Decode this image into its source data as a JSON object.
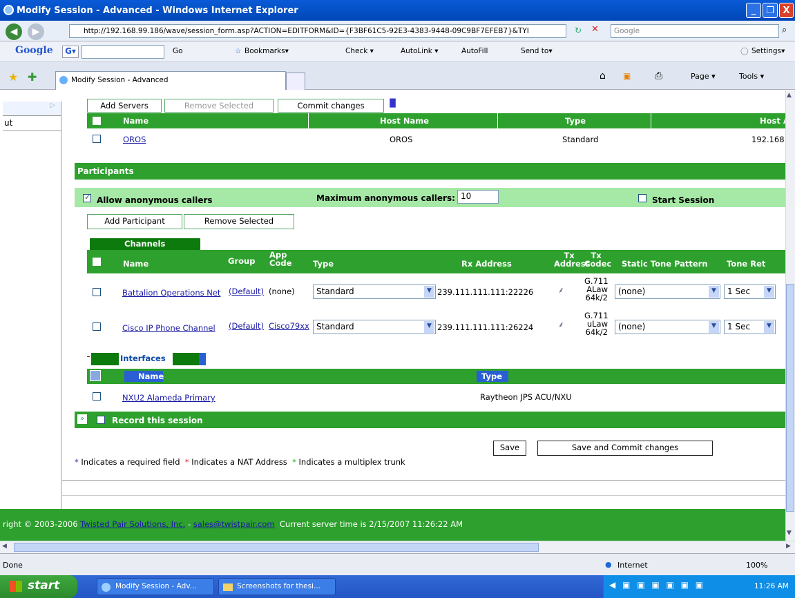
{
  "window": {
    "title": "Modify Session - Advanced - Windows Internet Explorer",
    "minimize": "_",
    "maximize": "❐",
    "close": "X"
  },
  "address": {
    "url": "http://192.168.99.186/wave/session_form.asp?ACTION=EDITFORM&ID={F3BF61C5-92E3-4383-9448-09C9BF7EFEB7}&TYI",
    "search_placeholder": "Google"
  },
  "google_bar": {
    "brand": "Google",
    "go": "Go",
    "bookmarks": "Bookmarks▾",
    "check": "Check ▾",
    "autolink": "AutoLink ▾",
    "autofill": "AutoFill",
    "send_to": "Send to▾",
    "settings": "Settings▾"
  },
  "tabs": {
    "active": "Modify Session - Advanced",
    "page": "Page ▾",
    "tools": "Tools ▾"
  },
  "left_nav": {
    "item": "ut"
  },
  "servers": {
    "buttons": {
      "add": "Add Servers",
      "remove": "Remove Selected",
      "commit": "Commit changes"
    },
    "headers": {
      "name": "Name",
      "host_name": "Host Name",
      "type": "Type",
      "host_address": "Host A"
    },
    "rows": [
      {
        "name": "OROS",
        "host_name": "OROS",
        "type": "Standard",
        "host_address": "192.168"
      }
    ]
  },
  "participants": {
    "title": "Participants",
    "allow_anonymous": "Allow anonymous callers",
    "max_anon_label": "Maximum anonymous callers:",
    "max_anon_value": "10",
    "start_session": "Start Session",
    "add_button": "Add Participant",
    "remove_button": "Remove Selected"
  },
  "channels": {
    "title": "Channels",
    "headers": {
      "name": "Name",
      "group": "Group",
      "app_code": "App Code",
      "type": "Type",
      "rx_address": "Rx Address",
      "tx_address": "Tx Address",
      "tx_codec": "Tx Codec",
      "static_tone": "Static Tone Pattern",
      "tone_ret": "Tone Ret"
    },
    "rows": [
      {
        "name": "Battalion Operations Net",
        "group": "(Default)",
        "app_code": "(none)",
        "type": "Standard",
        "rx": "239.111.111.111:22226",
        "codec": [
          "G.711",
          "ALaw",
          "64k/2"
        ],
        "tone": "(none)",
        "tone_ret": "1 Sec"
      },
      {
        "name": "Cisco IP Phone Channel",
        "group": "(Default)",
        "app_code": "Cisco79xx",
        "type": "Standard",
        "rx": "239.111.111.111:26224",
        "codec": [
          "G.711",
          "uLaw",
          "64k/2"
        ],
        "tone": "(none)",
        "tone_ret": "1 Sec"
      }
    ]
  },
  "interfaces": {
    "title": "Interfaces",
    "headers": {
      "name": "Name",
      "type": "Type"
    },
    "rows": [
      {
        "name": "NXU2 Alameda Primary",
        "type": "Raytheon JPS ACU/NXU"
      }
    ]
  },
  "record": {
    "label": "Record this session"
  },
  "actions": {
    "save": "Save",
    "save_commit": "Save and Commit changes"
  },
  "legend": {
    "required": "Indicates a required field",
    "nat": "Indicates a NAT Address",
    "multiplex": "Indicates a multiplex trunk",
    "star": "*"
  },
  "footer": {
    "copyright": "right © 2003-2006",
    "company": "Twisted Pair Solutions, Inc.",
    "dash": "-",
    "email": "sales@twistpair.com",
    "server_time": "Current server time is 2/15/2007 11:26:22 AM"
  },
  "status": {
    "left": "Done",
    "zone": "Internet",
    "zoom": "100%"
  },
  "taskbar": {
    "start": "start",
    "task1": "Modify Session - Adv...",
    "task2": "Screenshots for thesi...",
    "clock": "11:26 AM"
  },
  "colors": {
    "green": "#2da02d",
    "light_green": "#a6e8a6",
    "title_blue": "#0553c9"
  }
}
